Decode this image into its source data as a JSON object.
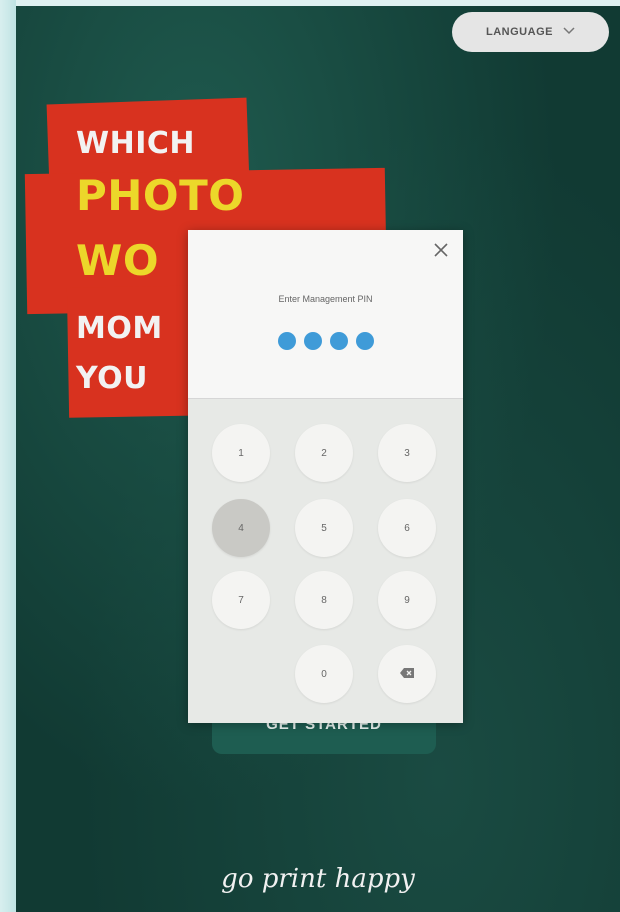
{
  "header": {
    "language_label": "LANGUAGE"
  },
  "headline": {
    "line1": "WHICH",
    "line2": "PHOTO",
    "line3": "WO",
    "line4": "MOM",
    "line5": "YOU"
  },
  "cta": {
    "label": "GET STARTED"
  },
  "footer": {
    "tagline": "go print happy"
  },
  "pin_modal": {
    "prompt": "Enter Management PIN",
    "entered_digits": 4,
    "keys": {
      "k1": "1",
      "k2": "2",
      "k3": "3",
      "k4": "4",
      "k5": "5",
      "k6": "6",
      "k7": "7",
      "k8": "8",
      "k9": "9",
      "k0": "0"
    },
    "pressed_key": "4"
  },
  "colors": {
    "background": "#113a33",
    "headline_block": "#d8321f",
    "headline_yellow": "#ecd72a",
    "pin_dot": "#3f9bd8"
  },
  "icons": {
    "language_dropdown": "chevron-down-icon",
    "close": "close-icon",
    "backspace": "backspace-icon"
  }
}
